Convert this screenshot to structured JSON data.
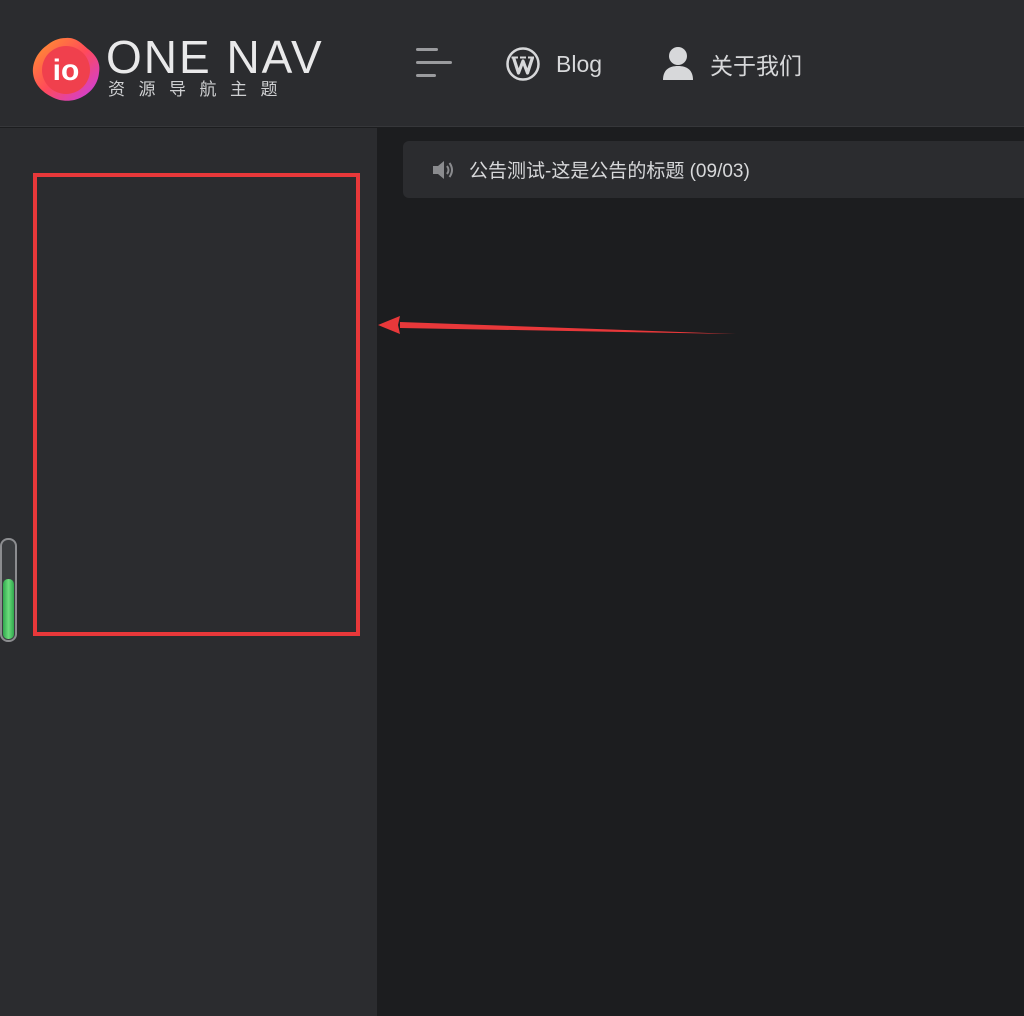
{
  "header": {
    "logo": {
      "mark": "io",
      "title": "ONE NAV",
      "subtitle": "资源导航主题",
      "icon": "io-logo-icon"
    },
    "menu_toggle_icon": "menu-icon",
    "nav": [
      {
        "label": "Blog",
        "icon": "wordpress-icon"
      },
      {
        "label": "关于我们",
        "icon": "user-icon"
      }
    ]
  },
  "sidebar": {
    "highlight_color": "#e8383a",
    "scroll_level": 0.6
  },
  "main": {
    "notice": {
      "icon": "speaker-icon",
      "text": "公告测试-这是公告的标题 (09/03)"
    }
  },
  "annotation": {
    "arrow_color": "#e8383a"
  }
}
